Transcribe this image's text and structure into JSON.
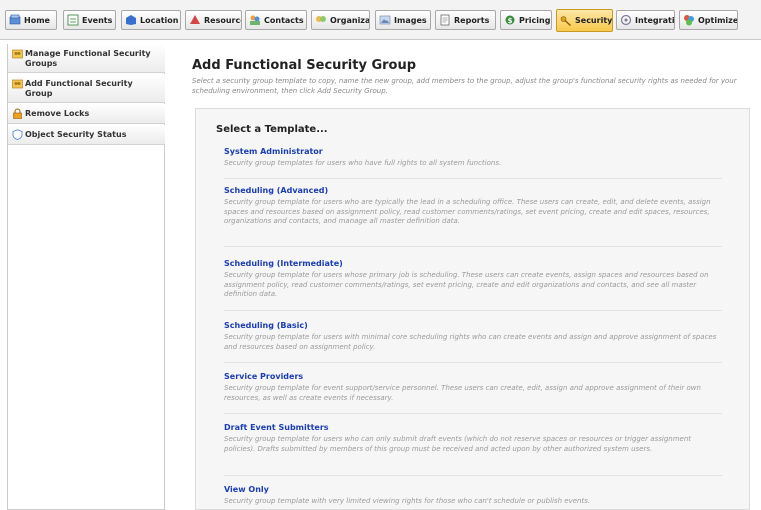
{
  "tabs": [
    {
      "label": "Home",
      "icon": "home-icon",
      "active": false
    },
    {
      "label": "Events",
      "icon": "events-icon",
      "active": false
    },
    {
      "label": "Location",
      "icon": "location-icon",
      "active": false
    },
    {
      "label": "Resource",
      "icon": "resource-icon",
      "active": false
    },
    {
      "label": "Contacts",
      "icon": "contacts-icon",
      "active": false
    },
    {
      "label": "Organiza",
      "icon": "organizations-icon",
      "active": false
    },
    {
      "label": "Images",
      "icon": "images-icon",
      "active": false
    },
    {
      "label": "Reports",
      "icon": "reports-icon",
      "active": false
    },
    {
      "label": "Pricing",
      "icon": "pricing-icon",
      "active": false
    },
    {
      "label": "Security",
      "icon": "key-icon",
      "active": true
    },
    {
      "label": "Integrati",
      "icon": "integration-icon",
      "active": false
    },
    {
      "label": "Optimize",
      "icon": "optimize-icon",
      "active": false
    }
  ],
  "sidebar": {
    "items": [
      {
        "label": "Manage Functional Security Groups",
        "icon": "group-icon"
      },
      {
        "label": "Add Functional Security Group",
        "icon": "group-add-icon"
      },
      {
        "label": "Remove Locks",
        "icon": "lock-icon"
      },
      {
        "label": "Object Security Status",
        "icon": "shield-icon"
      }
    ]
  },
  "main": {
    "title": "Add Functional Security Group",
    "description": "Select a security group template to copy, name the new group, add members to the group, adjust the group's functional security rights as needed for your scheduling environment, then click Add Security Group.",
    "select_heading": "Select a Template...",
    "templates": [
      {
        "name": "System Administrator",
        "description": "Security group templates for users who have full rights to all system functions."
      },
      {
        "name": "Scheduling (Advanced)",
        "description": "Security group template for users who are typically the lead in a scheduling office. These users can create, edit, and delete events, assign spaces and resources based on assignment policy, read customer comments/ratings, set event pricing, create and edit spaces, resources, organizations and contacts, and manage all master definition data."
      },
      {
        "name": "Scheduling (Intermediate)",
        "description": "Security group template for users whose primary job is scheduling. These users can create events, assign spaces and resources based on assignment policy, read customer comments/ratings, set event pricing, create and edit organizations and contacts, and see all master definition data."
      },
      {
        "name": "Scheduling (Basic)",
        "description": "Security group template for users with minimal core scheduling rights who can create events and assign and approve assignment of spaces and resources based on assignment policy."
      },
      {
        "name": "Service Providers",
        "description": "Security group template for event support/service personnel. These users can create, edit, assign and approve assignment of their own resources, as well as create events if necessary."
      },
      {
        "name": "Draft Event Submitters",
        "description": "Security group template for users who can only submit draft events (which do not reserve spaces or resources or trigger assignment policies). Drafts submitted by members of this group must be received and acted upon by other authorized system users."
      },
      {
        "name": "View Only",
        "description": "Security group template with very limited viewing rights for those who can't schedule or publish events."
      }
    ]
  },
  "colors": {
    "link": "#1b3db8",
    "active_tab": "#f8c94c",
    "panel_bg": "#f6f6f6"
  }
}
